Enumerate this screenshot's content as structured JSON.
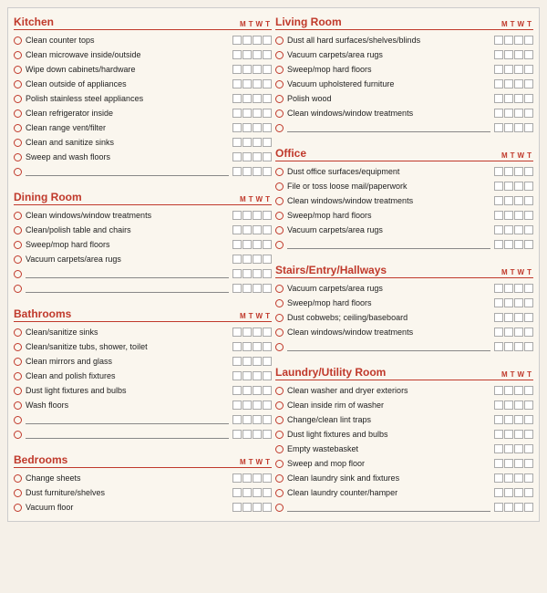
{
  "columns": [
    {
      "sections": [
        {
          "title": "Kitchen",
          "items": [
            "Clean counter tops",
            "Clean microwave inside/outside",
            "Wipe down cabinets/hardware",
            "Clean outside of appliances",
            "Polish stainless steel appliances",
            "Clean refrigerator inside",
            "Clean range vent/filter",
            "Clean and sanitize sinks",
            "Sweep and wash floors"
          ],
          "blanks": 1
        },
        {
          "title": "Dining Room",
          "items": [
            "Clean windows/window treatments",
            "Clean/polish table and chairs",
            "Sweep/mop hard floors",
            "Vacuum carpets/area rugs"
          ],
          "blanks": 2
        },
        {
          "title": "Bathrooms",
          "items": [
            "Clean/sanitize sinks",
            "Clean/sanitize tubs, shower, toilet",
            "Clean mirrors and glass",
            "Clean and polish fixtures",
            "Dust light fixtures and bulbs",
            "Wash floors"
          ],
          "blanks": 2
        },
        {
          "title": "Bedrooms",
          "items": [
            "Change sheets",
            "Dust furniture/shelves",
            "Vacuum floor"
          ],
          "blanks": 0
        }
      ]
    },
    {
      "sections": [
        {
          "title": "Living Room",
          "items": [
            "Dust all hard surfaces/shelves/blinds",
            "Vacuum carpets/area rugs",
            "Sweep/mop hard floors",
            "Vacuum upholstered furniture",
            "Polish wood",
            "Clean windows/window treatments"
          ],
          "blanks": 1
        },
        {
          "title": "Office",
          "items": [
            "Dust office surfaces/equipment",
            "File or toss loose mail/paperwork",
            "Clean windows/window treatments",
            "Sweep/mop hard floors",
            "Vacuum carpets/area rugs"
          ],
          "blanks": 1
        },
        {
          "title": "Stairs/Entry/Hallways",
          "items": [
            "Vacuum carpets/area rugs",
            "Sweep/mop hard floors",
            "Dust cobwebs; ceiling/baseboard",
            "Clean windows/window treatments"
          ],
          "blanks": 1
        },
        {
          "title": "Laundry/Utility Room",
          "items": [
            "Clean washer and dryer exteriors",
            "Clean inside rim of washer",
            "Change/clean lint traps",
            "Dust light fixtures and bulbs",
            "Empty wastebasket",
            "Sweep and mop floor",
            "Clean laundry sink and fixtures",
            "Clean laundry counter/hamper"
          ],
          "blanks": 1
        }
      ]
    }
  ]
}
